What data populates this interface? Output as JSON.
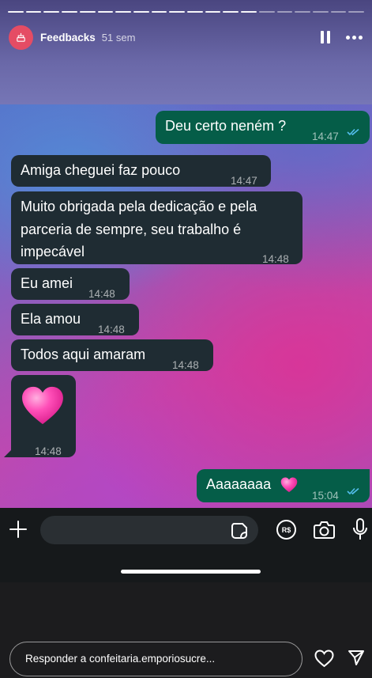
{
  "story": {
    "username": "Feedbacks",
    "time_ago": "51 sem",
    "segments_total": 20,
    "segments_viewed": 14,
    "icons": [
      "pause-icon",
      "more-icon"
    ]
  },
  "chat": {
    "messages": [
      {
        "id": "m1",
        "dir": "out",
        "text": "Deu certo neném ?",
        "time": "14:47",
        "read": true
      },
      {
        "id": "m2",
        "dir": "in",
        "text": "Amiga cheguei faz pouco",
        "time": "14:47"
      },
      {
        "id": "m3",
        "dir": "in",
        "lines": [
          "Muito obrigada pela dedicação e pela",
          "parceria de sempre, seu trabalho é",
          "impecável"
        ],
        "time": "14:48"
      },
      {
        "id": "m4",
        "dir": "in",
        "text": "Eu amei",
        "time": "14:48"
      },
      {
        "id": "m5",
        "dir": "in",
        "text": "Ela amou",
        "time": "14:48"
      },
      {
        "id": "m6",
        "dir": "in",
        "text": "Todos aqui amaram",
        "time": "14:48"
      },
      {
        "id": "m7",
        "dir": "in",
        "emoji": "pink-heart-icon",
        "time": "14:48"
      },
      {
        "id": "m8",
        "dir": "out",
        "text": "Aaaaaaaa",
        "emoji": "pink-heart-icon",
        "time": "15:04",
        "read": true
      }
    ],
    "colors": {
      "incoming": "#1f2c33",
      "outgoing": "#055d48",
      "read_ticks": "#53bdeb"
    }
  },
  "wa_input_bar": {
    "icons": [
      "plus-icon",
      "sticker-icon",
      "pix-rs-icon",
      "camera-icon",
      "microphone-icon"
    ]
  },
  "reply": {
    "placeholder": "Responder a confeitaria.emporiosucre...",
    "icons": [
      "heart-icon",
      "send-icon"
    ]
  }
}
